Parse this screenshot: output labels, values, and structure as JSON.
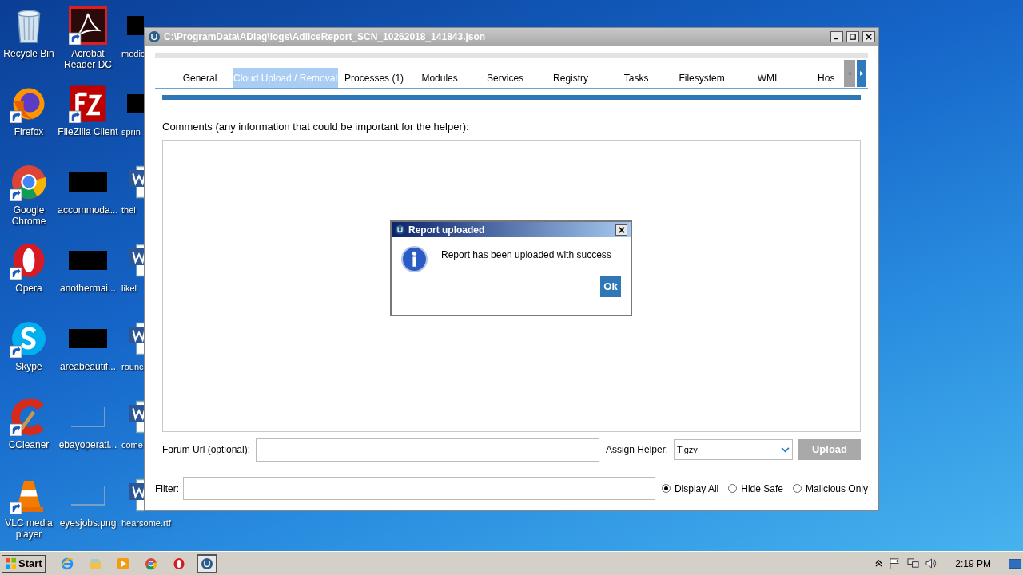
{
  "desktop": {
    "columns": [
      {
        "icons": [
          {
            "label": "Recycle Bin",
            "kind": "bin",
            "shortcut": false
          },
          {
            "label": "Firefox",
            "kind": "firefox",
            "shortcut": true
          },
          {
            "label": "Google Chrome",
            "kind": "chrome",
            "shortcut": true
          },
          {
            "label": "Opera",
            "kind": "opera",
            "shortcut": true
          },
          {
            "label": "Skype",
            "kind": "skype",
            "shortcut": true
          },
          {
            "label": "CCleaner",
            "kind": "ccleaner",
            "shortcut": true
          },
          {
            "label": "VLC media player",
            "kind": "vlc",
            "shortcut": true
          }
        ]
      },
      {
        "icons": [
          {
            "label": "Acrobat Reader DC",
            "kind": "pdf",
            "shortcut": true
          },
          {
            "label": "FileZilla Client",
            "kind": "filezilla",
            "shortcut": true
          },
          {
            "label": "accommoda...",
            "kind": "black",
            "shortcut": false
          },
          {
            "label": "anothermai...",
            "kind": "black",
            "shortcut": false
          },
          {
            "label": "areabeautif...",
            "kind": "black",
            "shortcut": false
          },
          {
            "label": "ebayoperati...",
            "kind": "blank",
            "shortcut": false
          },
          {
            "label": "eyesjobs.png",
            "kind": "blank",
            "shortcut": false
          }
        ]
      },
      {
        "icons": [
          {
            "label": "medic",
            "kind": "black",
            "shortcut": false
          },
          {
            "label": "sprin",
            "kind": "black",
            "shortcut": false
          },
          {
            "label": "thei",
            "kind": "doc",
            "shortcut": false
          },
          {
            "label": "likel",
            "kind": "doc",
            "shortcut": false
          },
          {
            "label": "rounc",
            "kind": "doc",
            "shortcut": false
          },
          {
            "label": "come",
            "kind": "doc",
            "shortcut": false
          },
          {
            "label": "hearsome.rtf",
            "kind": "doc",
            "shortcut": false
          }
        ]
      }
    ]
  },
  "window": {
    "title": "C:\\ProgramData\\ADiag\\logs\\AdliceReport_SCN_10262018_141843.json"
  },
  "tabs": [
    {
      "label": "General",
      "selected": false
    },
    {
      "label": "Cloud Upload / Removal",
      "selected": true
    },
    {
      "label": "Processes (1)",
      "selected": false
    },
    {
      "label": "Modules",
      "selected": false
    },
    {
      "label": "Services",
      "selected": false
    },
    {
      "label": "Registry",
      "selected": false
    },
    {
      "label": "Tasks",
      "selected": false
    },
    {
      "label": "Filesystem",
      "selected": false
    },
    {
      "label": "WMI",
      "selected": false
    },
    {
      "label": "Hos",
      "selected": false
    }
  ],
  "comments": {
    "label": "Comments (any information that could be important for the helper):"
  },
  "forum_url": {
    "label": "Forum Url (optional):"
  },
  "assign_helper": {
    "label": "Assign Helper:",
    "value": "Tigzy"
  },
  "upload_button": {
    "label": "Upload",
    "disabled": true
  },
  "filter": {
    "label": "Filter:"
  },
  "filter_options": [
    {
      "label": "Display All",
      "selected": true
    },
    {
      "label": "Hide Safe",
      "selected": false
    },
    {
      "label": "Malicious Only",
      "selected": false
    }
  ],
  "dialog": {
    "title": "Report uploaded",
    "message": "Report has been uploaded with success",
    "button": "Ok"
  },
  "taskbar": {
    "start": "Start",
    "items": [
      {
        "kind": "ie",
        "active": false
      },
      {
        "kind": "explorer",
        "active": false
      },
      {
        "kind": "media",
        "active": false
      },
      {
        "kind": "chrome",
        "active": false
      },
      {
        "kind": "opera",
        "active": false
      },
      {
        "kind": "adlice",
        "active": true
      }
    ],
    "clock": "2:19 PM"
  }
}
